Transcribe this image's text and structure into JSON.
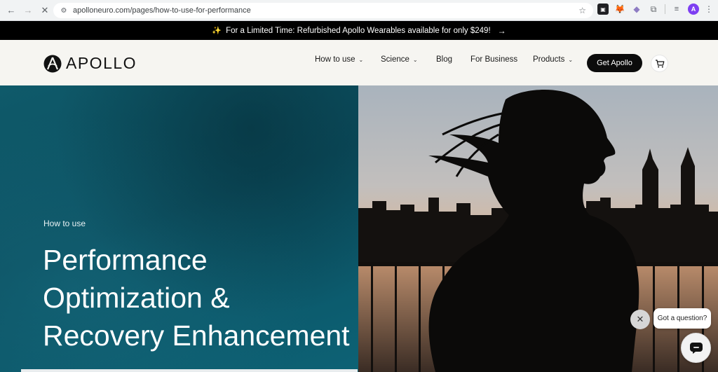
{
  "browser": {
    "url": "apolloneuro.com/pages/how-to-use-for-performance",
    "profile_initial": "A",
    "back_icon": "arrow-left-icon",
    "forward_icon": "arrow-right-icon",
    "stop_icon": "close-icon"
  },
  "promo": {
    "text": "For a Limited Time: Refurbished Apollo Wearables available for only $249!"
  },
  "header": {
    "logo_text": "APOLLO",
    "nav": [
      {
        "label": "How to use"
      },
      {
        "label": "Science"
      },
      {
        "label": "Blog"
      },
      {
        "label": "For Business"
      },
      {
        "label": "Products"
      }
    ],
    "cta_label": "Get Apollo"
  },
  "hero": {
    "eyebrow": "How to use",
    "title": "Performance Optimization & Recovery Enhancement"
  },
  "chat": {
    "prompt": "Got a question?"
  },
  "colors": {
    "hero_teal": "#0d5565",
    "promo_bg": "#000000",
    "header_bg": "#f6f5f1",
    "cta_bg": "#0c0c0c"
  }
}
